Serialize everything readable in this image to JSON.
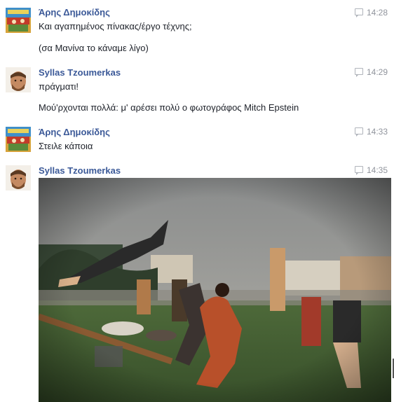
{
  "messages": [
    {
      "sender": "Άρης Δημοκίδης",
      "time": "14:28",
      "lines": [
        "Και αγαπημένος πίνακας/έργο τέχνης;",
        "(σα Μανίνα το κάναμε λίγο)"
      ]
    },
    {
      "sender": "Syllas Tzoumerkas",
      "time": "14:29",
      "lines": [
        "πράγματι!",
        "Μού'ρχονται πολλά: μ' αρέσει πολύ ο φωτογράφος Mitch Epstein"
      ]
    },
    {
      "sender": "Άρης Δημοκίδης",
      "time": "14:33",
      "lines": [
        "Στειλε κάποια"
      ]
    },
    {
      "sender": "Syllas Tzoumerkas",
      "time": "14:35",
      "lines": []
    }
  ],
  "icons": {
    "timestamp": "chat-bubble-icon"
  },
  "colors": {
    "sender_name": "#3b5998",
    "timestamp": "#90949c",
    "message_text": "#1d2129"
  }
}
